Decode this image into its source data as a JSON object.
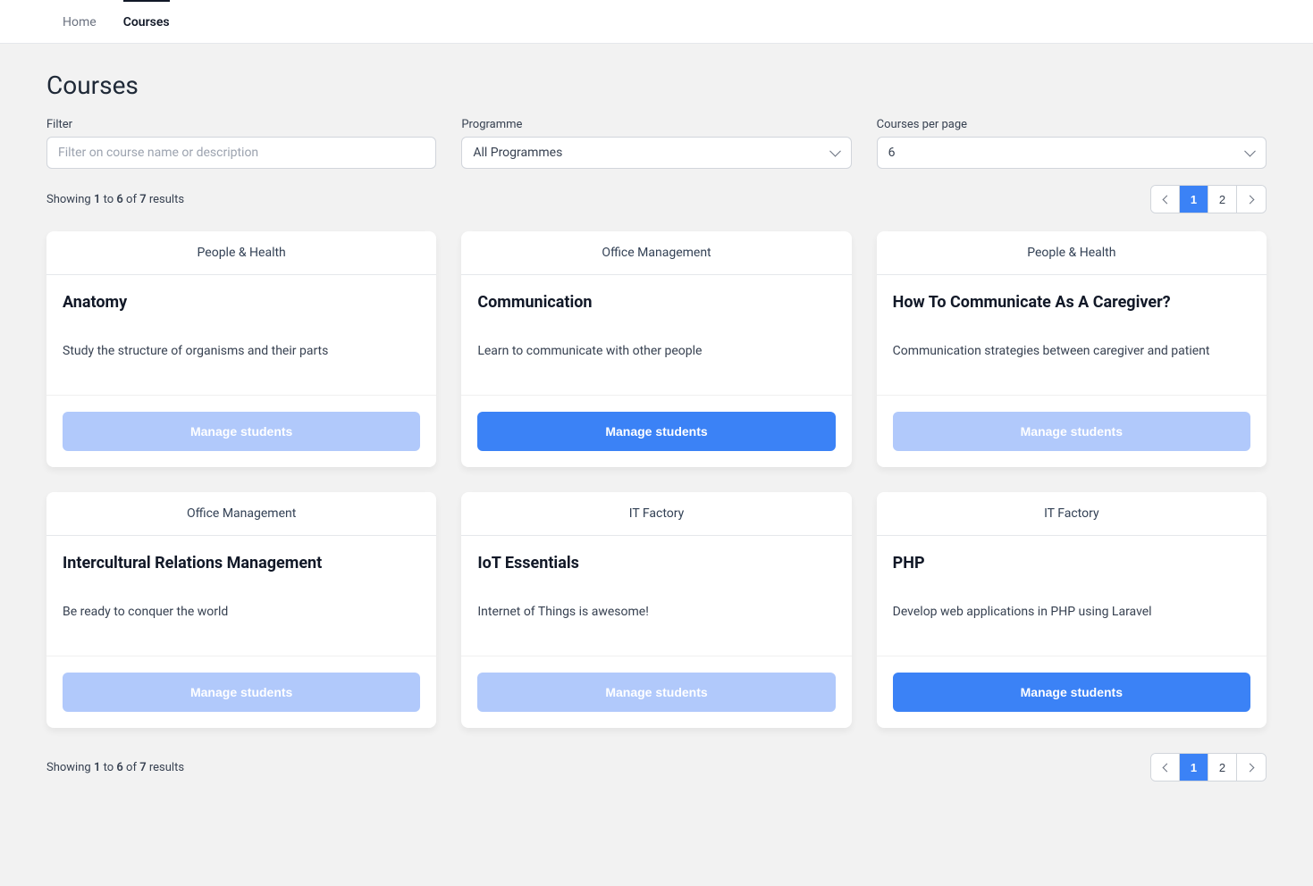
{
  "nav": {
    "home": "Home",
    "courses": "Courses"
  },
  "title": "Courses",
  "filters": {
    "filter_label": "Filter",
    "filter_placeholder": "Filter on course name or description",
    "programme_label": "Programme",
    "programme_value": "All Programmes",
    "perpage_label": "Courses per page",
    "perpage_value": "6"
  },
  "results": {
    "prefix": "Showing ",
    "from": "1",
    "to_word": " to ",
    "to": "6",
    "of_word": " of ",
    "total": "7",
    "suffix": " results"
  },
  "pagination": {
    "pages": [
      "1",
      "2"
    ],
    "active": "1"
  },
  "cards": [
    {
      "programme": "People & Health",
      "title": "Anatomy",
      "desc": "Study the structure of organisms and their parts",
      "btn": "Manage students",
      "enabled": false
    },
    {
      "programme": "Office Management",
      "title": "Communication",
      "desc": "Learn to communicate with other people",
      "btn": "Manage students",
      "enabled": true
    },
    {
      "programme": "People & Health",
      "title": "How To Communicate As A Caregiver?",
      "desc": "Communication strategies between caregiver and patient",
      "btn": "Manage students",
      "enabled": false
    },
    {
      "programme": "Office Management",
      "title": "Intercultural Relations Management",
      "desc": "Be ready to conquer the world",
      "btn": "Manage students",
      "enabled": false
    },
    {
      "programme": "IT Factory",
      "title": "IoT Essentials",
      "desc": "Internet of Things is awesome!",
      "btn": "Manage students",
      "enabled": false
    },
    {
      "programme": "IT Factory",
      "title": "PHP",
      "desc": "Develop web applications in PHP using Laravel",
      "btn": "Manage students",
      "enabled": true
    }
  ]
}
